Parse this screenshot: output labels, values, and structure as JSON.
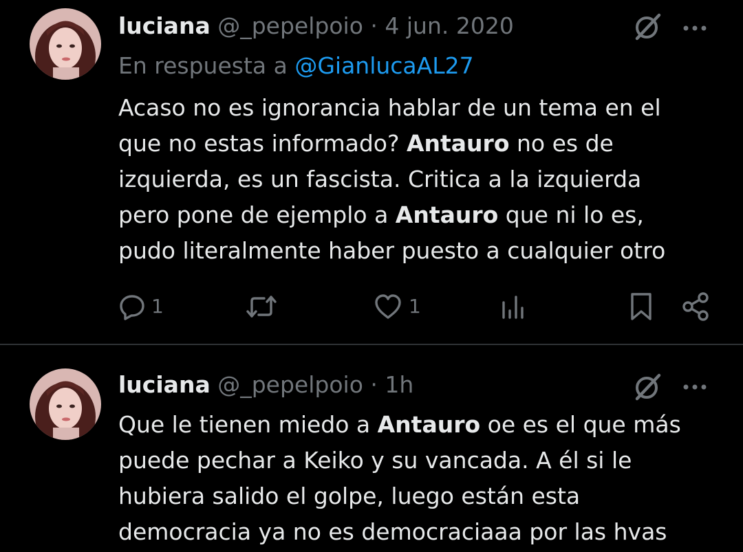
{
  "tweets": [
    {
      "name": "luciana",
      "handle": "@_pepelpoio",
      "separator": "·",
      "date": "4 jun. 2020",
      "reply_prefix": "En respuesta a ",
      "reply_mention": "@GianlucaAL27",
      "lines": [
        [
          {
            "t": "Acaso no es ignorancia hablar de un tema en el"
          }
        ],
        [
          {
            "t": "que no estas informado? "
          },
          {
            "t": "Antauro",
            "bold": true
          },
          {
            "t": " no es de"
          }
        ],
        [
          {
            "t": "izquierda, es un fascista. Critica a la izquierda"
          }
        ],
        [
          {
            "t": "pero pone de ejemplo a "
          },
          {
            "t": "Antauro",
            "bold": true
          },
          {
            "t": " que ni lo es,"
          }
        ],
        [
          {
            "t": "pudo literalmente haber puesto a cualquier otro"
          }
        ]
      ],
      "actions": {
        "reply_count": "1",
        "like_count": "1"
      },
      "icons": [
        "grok-icon",
        "more-icon",
        "reply-icon",
        "retweet-icon",
        "like-icon",
        "views-icon",
        "bookmark-icon",
        "share-icon"
      ]
    },
    {
      "name": "luciana",
      "handle": "@_pepelpoio",
      "separator": "·",
      "date": "1h",
      "lines": [
        [
          {
            "t": "Que le tienen miedo a "
          },
          {
            "t": "Antauro",
            "bold": true
          },
          {
            "t": " oe es el que más"
          }
        ],
        [
          {
            "t": "puede pechar a Keiko y su vancada. A él si le"
          }
        ],
        [
          {
            "t": "hubiera salido el golpe, luego están esta"
          }
        ],
        [
          {
            "t": "democracia ya no es democraciaaa por las hvas"
          }
        ]
      ],
      "icons": [
        "grok-icon",
        "more-icon"
      ]
    }
  ],
  "colors": {
    "background": "#000000",
    "text": "#e7e9ea",
    "muted": "#71767b",
    "link": "#1d9bf0",
    "divider": "#2f3336"
  }
}
